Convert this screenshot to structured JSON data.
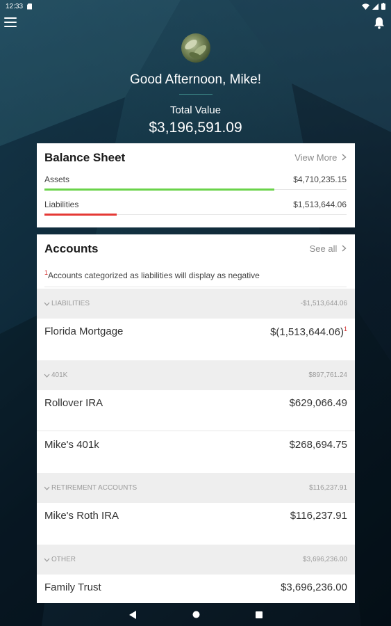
{
  "status_bar": {
    "time": "12:33"
  },
  "hero": {
    "greeting": "Good Afternoon, Mike!",
    "total_label": "Total Value",
    "total_value": "$3,196,591.09"
  },
  "balance_sheet": {
    "title": "Balance Sheet",
    "view_more": "View More",
    "assets": {
      "label": "Assets",
      "value": "$4,710,235.15",
      "bar_fraction": 0.76,
      "bar_color": "#6ad34a"
    },
    "liabilities": {
      "label": "Liabilities",
      "value": "$1,513,644.06",
      "bar_fraction": 0.24,
      "bar_color": "#e53935"
    }
  },
  "accounts": {
    "title": "Accounts",
    "see_all": "See all",
    "footnote_marker": "1",
    "footnote": "Accounts categorized as liabilities will display as negative",
    "groups": [
      {
        "name": "LIABILITIES",
        "total": "-$1,513,644.06",
        "items": [
          {
            "name": "Florida Mortgage",
            "value": "$(1,513,644.06)",
            "marker": "1"
          }
        ]
      },
      {
        "name": "401K",
        "total": "$897,761.24",
        "items": [
          {
            "name": "Rollover IRA",
            "value": "$629,066.49"
          },
          {
            "name": "Mike's 401k",
            "value": "$268,694.75"
          }
        ]
      },
      {
        "name": "RETIREMENT ACCOUNTS",
        "total": "$116,237.91",
        "items": [
          {
            "name": "Mike's Roth IRA",
            "value": "$116,237.91"
          }
        ]
      },
      {
        "name": "OTHER",
        "total": "$3,696,236.00",
        "items": [
          {
            "name": "Family Trust",
            "value": "$3,696,236.00"
          }
        ]
      }
    ]
  },
  "colors": {
    "accent_divider": "#3f8c8a",
    "negative": "#d32f2f"
  }
}
